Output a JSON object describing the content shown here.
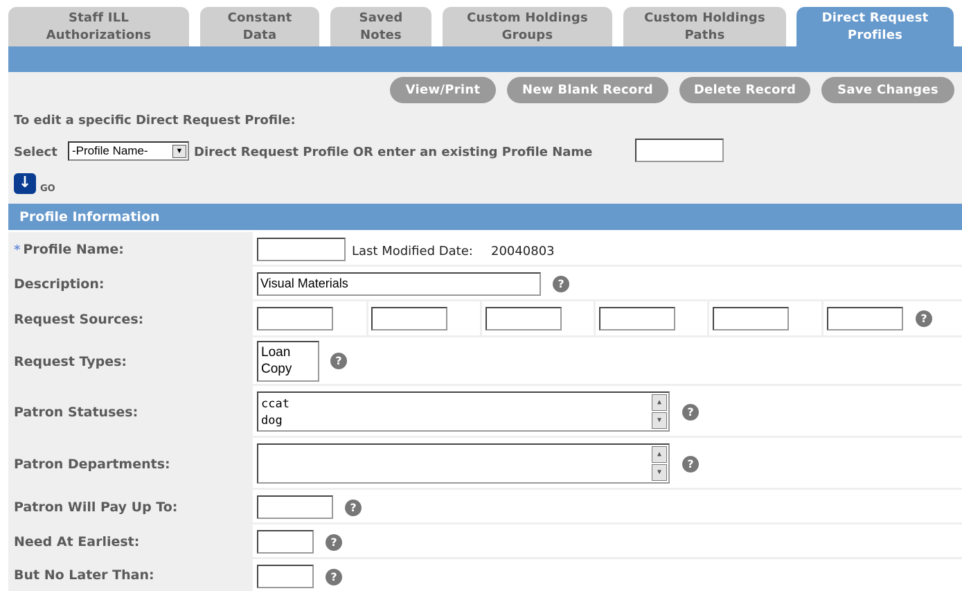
{
  "tabs": [
    {
      "label": "Staff ILL\nAuthorizations"
    },
    {
      "label": "Constant\nData"
    },
    {
      "label": "Saved\nNotes"
    },
    {
      "label": "Custom Holdings\nGroups"
    },
    {
      "label": "Custom Holdings\nPaths"
    },
    {
      "label": "Direct Request\nProfiles"
    }
  ],
  "toolbar": {
    "view_print": "View/Print",
    "new_blank": "New Blank Record",
    "delete": "Delete Record",
    "save": "Save Changes"
  },
  "selector": {
    "instruction": "To edit a specific Direct Request Profile:",
    "select_label": "Select",
    "select_value": "-Profile Name-",
    "after_select": "Direct Request Profile OR enter an existing Profile Name",
    "profile_name_input": "",
    "go_label": "GO"
  },
  "section": {
    "title": "Profile Information"
  },
  "icons": {
    "help": "?",
    "go_arrow": "↓",
    "required": "*",
    "dropdown": "▼",
    "scroll_up": "▲",
    "scroll_down": "▼"
  },
  "fields": {
    "profile_name": {
      "label": "Profile Name:",
      "value": "",
      "modified_label": "Last Modified Date:",
      "modified_value": "20040803"
    },
    "description": {
      "label": "Description:",
      "value": "Visual Materials"
    },
    "request_sources": {
      "label": "Request Sources:",
      "values": [
        "",
        "",
        "",
        "",
        "",
        ""
      ]
    },
    "request_types": {
      "label": "Request Types:",
      "options": [
        "Loan",
        "Copy"
      ]
    },
    "patron_statuses": {
      "label": "Patron Statuses:",
      "value_lines": [
        "ccat",
        "dog"
      ]
    },
    "patron_departments": {
      "label": "Patron Departments:",
      "value": ""
    },
    "patron_will_pay": {
      "label": "Patron Will Pay Up To:",
      "value": ""
    },
    "need_at_earliest": {
      "label": "Need At Earliest:",
      "value": ""
    },
    "no_later_than": {
      "label": "But No Later Than:",
      "value": ""
    }
  }
}
